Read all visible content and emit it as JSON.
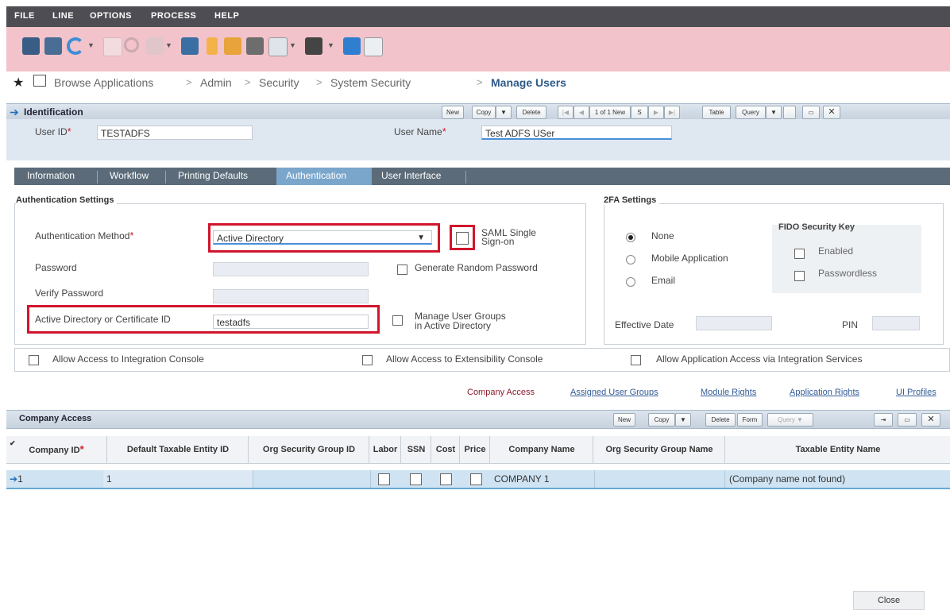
{
  "menu": [
    "FILE",
    "LINE",
    "OPTIONS",
    "PROCESS",
    "HELP"
  ],
  "breadcrumb": [
    "Browse Applications",
    "Admin",
    "Security",
    "System Security",
    "Manage Users"
  ],
  "breadcrumb_sep": ">",
  "identification": {
    "title": "Identification",
    "buttons": {
      "new": "New",
      "copy": "Copy",
      "delete": "Delete",
      "record": "1 of 1 New",
      "table": "Table",
      "query": "Query"
    },
    "user_id_label": "User ID",
    "user_id_value": "TESTADFS",
    "user_name_label": "User Name",
    "user_name_value": "Test ADFS USer"
  },
  "tabs": [
    "Information",
    "Workflow",
    "Printing Defaults",
    "Authentication",
    "User Interface"
  ],
  "auth": {
    "section_title": "Authentication Settings",
    "method_label": "Authentication Method",
    "method_value": "Active Directory",
    "saml_label_1": "SAML Single",
    "saml_label_2": "Sign-on",
    "password_label": "Password",
    "gen_random_label": "Generate Random Password",
    "verify_label": "Verify Password",
    "ad_cert_label": "Active Directory or Certificate ID",
    "ad_cert_value": "testadfs",
    "manage_groups_1": "Manage User Groups",
    "manage_groups_2": "in Active Directory"
  },
  "twofa": {
    "section_title": "2FA Settings",
    "none": "None",
    "mobile": "Mobile Application",
    "email": "Email",
    "fido_title": "FIDO Security Key",
    "enabled": "Enabled",
    "passwordless": "Passwordless",
    "effective_date": "Effective Date",
    "pin": "PIN"
  },
  "access": {
    "integration": "Allow Access to Integration Console",
    "extensibility": "Allow Access to Extensibility Console",
    "services": "Allow Application Access via Integration Services"
  },
  "links": [
    "Company Access",
    "Assigned User Groups",
    "Module Rights",
    "Application Rights",
    "UI Profiles"
  ],
  "company_access": {
    "title": "Company Access",
    "buttons": {
      "new": "New",
      "copy": "Copy",
      "delete": "Delete",
      "form": "Form",
      "query": "Query"
    },
    "columns": [
      "Company ID",
      "Default Taxable Entity ID",
      "Org Security Group ID",
      "Labor",
      "SSN",
      "Cost",
      "Price",
      "Company Name",
      "Org Security Group Name",
      "Taxable Entity Name"
    ],
    "row": {
      "company_id": "1",
      "default_taxable": "1",
      "org_group_id": "",
      "company_name": "COMPANY 1",
      "org_group_name": "",
      "taxable_entity_name": "(Company name not found)"
    }
  },
  "close_label": "Close",
  "colors": {
    "menubar": "#4d4d53",
    "toolbar": "#f2c3ca",
    "tabs": "#5b6b79",
    "active_tab": "#7ba6cc",
    "highlight": "#d1152d",
    "row": "#cfe3f2"
  }
}
